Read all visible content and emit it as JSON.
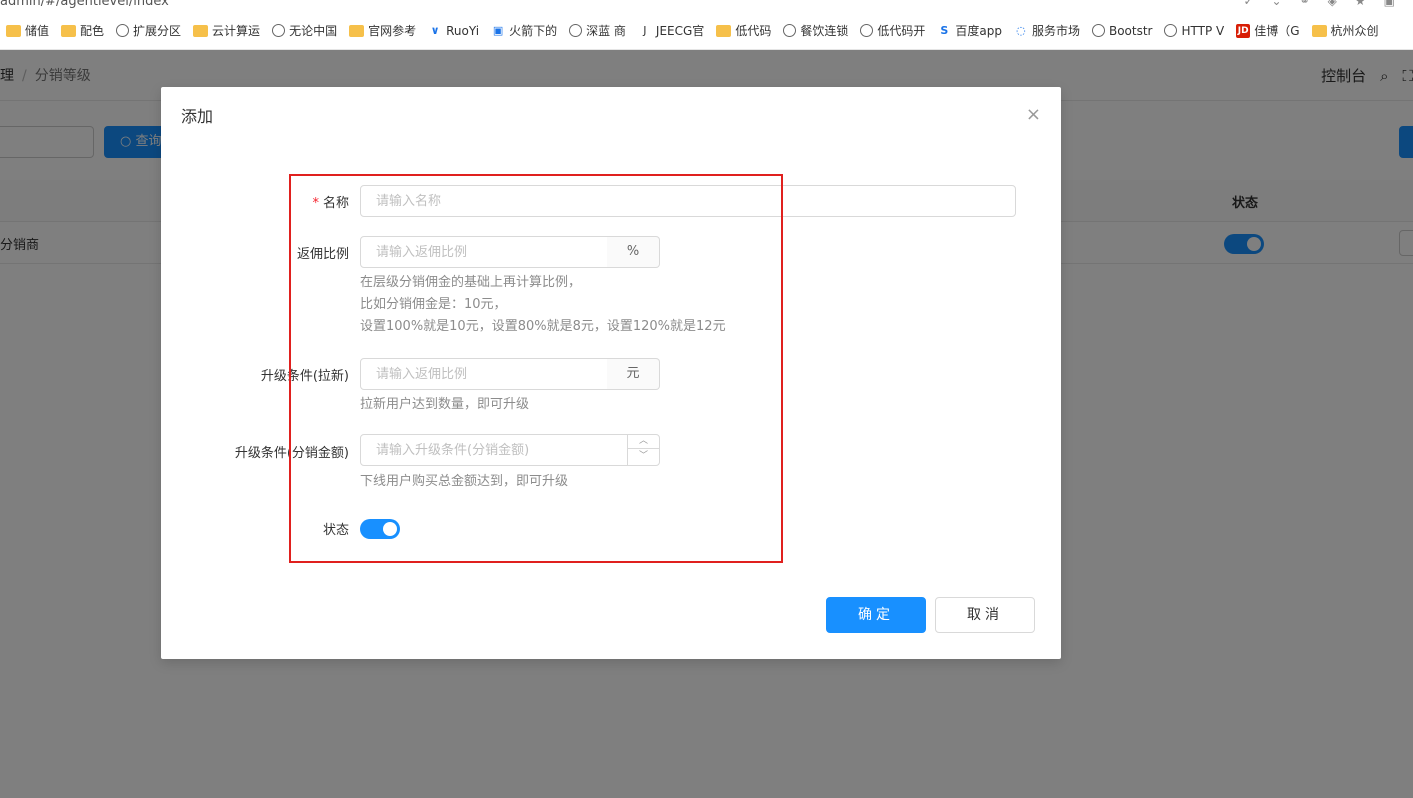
{
  "browser": {
    "url": "admin/#/agentlevel/index",
    "bookmarks": [
      {
        "label": "储值",
        "icon": "folder-icon"
      },
      {
        "label": "配色",
        "icon": "folder-icon"
      },
      {
        "label": "扩展分区",
        "icon": "globe-icon"
      },
      {
        "label": "云计算运",
        "icon": "folder-icon"
      },
      {
        "label": "无论中国",
        "icon": "globe-icon"
      },
      {
        "label": "官网参考",
        "icon": "folder-icon"
      },
      {
        "label": "RuoYi",
        "icon": "vue-icon"
      },
      {
        "label": "火箭下的",
        "icon": "bilibili-icon"
      },
      {
        "label": "深蓝 商",
        "icon": "globe-icon"
      },
      {
        "label": "JEECG官",
        "icon": "j-icon"
      },
      {
        "label": "低代码",
        "icon": "folder-icon"
      },
      {
        "label": "餐饮连锁",
        "icon": "globe-icon"
      },
      {
        "label": "低代码开",
        "icon": "globe-icon"
      },
      {
        "label": "百度app",
        "icon": "baidu-icon"
      },
      {
        "label": "服务市场",
        "icon": "service-icon"
      },
      {
        "label": "Bootstr",
        "icon": "globe-icon"
      },
      {
        "label": "HTTP V",
        "icon": "globe-icon"
      },
      {
        "label": "佳博（G",
        "icon": "jd-icon"
      },
      {
        "label": "杭州众创",
        "icon": "folder-icon"
      }
    ]
  },
  "app": {
    "breadcrumb": {
      "parent": "理",
      "separator": "/",
      "current": "分销等级"
    },
    "nav_right": {
      "console": "控制台"
    },
    "query_button": "查询",
    "table": {
      "status_header": "状态",
      "rows": [
        {
          "name": "分销商"
        }
      ]
    }
  },
  "modal": {
    "title": "添加",
    "close": "×",
    "fields": {
      "name": {
        "label": "名称",
        "required_mark": "*",
        "placeholder": "请输入名称",
        "value": ""
      },
      "rebate": {
        "label": "返佣比例",
        "placeholder": "请输入返佣比例",
        "suffix": "%",
        "help": [
          "在层级分销佣金的基础上再计算比例，",
          "比如分销佣金是：10元，",
          "设置100%就是10元，设置80%就是8元，设置120%就是12元"
        ]
      },
      "upgrade_invite": {
        "label": "升级条件(拉新)",
        "placeholder": "请输入返佣比例",
        "suffix": "元",
        "help": "拉新用户达到数量，即可升级"
      },
      "upgrade_amount": {
        "label": "升级条件(分销金额)",
        "placeholder": "请输入升级条件(分销金额)",
        "stepper_up": "︿",
        "stepper_down": "﹀",
        "help": "下线用户购买总金额达到，即可升级"
      },
      "status": {
        "label": "状态",
        "value": true
      }
    },
    "buttons": {
      "confirm": "确定",
      "cancel": "取消"
    }
  },
  "colors": {
    "primary": "#1890ff",
    "highlight": "#e0201e",
    "mask": "rgba(0,0,0,0.5)"
  }
}
